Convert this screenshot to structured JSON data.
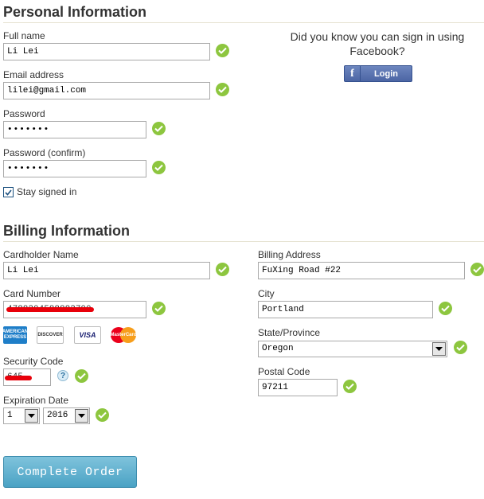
{
  "personal": {
    "title": "Personal Information",
    "full_name": {
      "label": "Full name",
      "value": "Li Lei"
    },
    "email": {
      "label": "Email address",
      "value": "lilei@gmail.com"
    },
    "password": {
      "label": "Password",
      "value": "•••••••"
    },
    "password_confirm": {
      "label": "Password (confirm)",
      "value": "•••••••"
    },
    "stay_signed_in": {
      "label": "Stay signed in",
      "checked": true
    }
  },
  "facebook": {
    "prompt": "Did you know you can sign in using Facebook?",
    "button_label": "Login",
    "icon_glyph": "f"
  },
  "billing": {
    "title": "Billing Information",
    "cardholder": {
      "label": "Cardholder Name",
      "value": "Li Lei"
    },
    "card_number": {
      "label": "Card Number",
      "value": "4788204588883700"
    },
    "card_logos": [
      "AMERICAN EXPRESS",
      "DISCOVER",
      "VISA",
      "MasterCard"
    ],
    "security_code": {
      "label": "Security Code",
      "value": "645",
      "help": "?"
    },
    "expiration": {
      "label": "Expiration Date",
      "month": "1",
      "year": "2016"
    },
    "address": {
      "label": "Billing Address",
      "value": "FuXing Road #22"
    },
    "city": {
      "label": "City",
      "value": "Portland"
    },
    "state": {
      "label": "State/Province",
      "value": "Oregon"
    },
    "postal": {
      "label": "Postal Code",
      "value": "97211"
    }
  },
  "submit": {
    "label": "Complete Order"
  },
  "colors": {
    "check": "#8dc63f",
    "facebook": "#4c65a4",
    "submit": "#4aa2c4"
  },
  "icons": {
    "valid": "check-icon",
    "dropdown": "chevron-down-icon",
    "help": "help-icon"
  }
}
